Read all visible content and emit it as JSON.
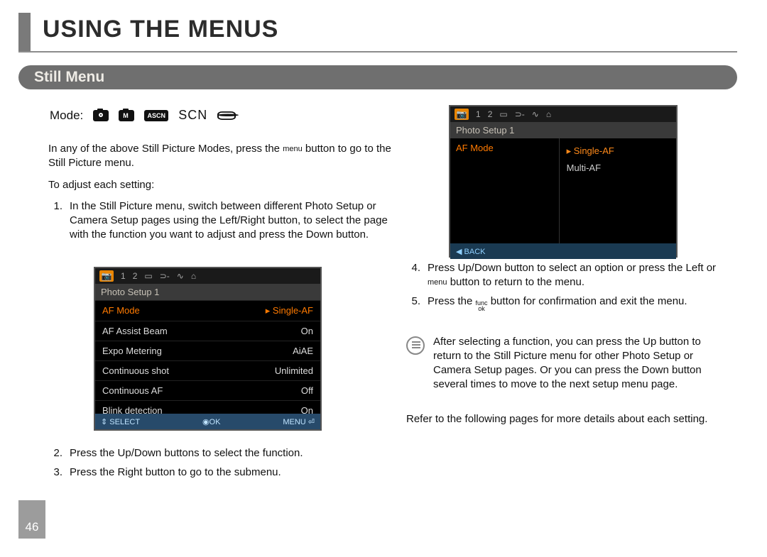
{
  "header": {
    "title": "USING THE MENUS"
  },
  "section": {
    "title": "Still Menu"
  },
  "mode": {
    "label": "Mode:",
    "ascn": "ASCN",
    "scn": "SCN"
  },
  "left": {
    "p1a": "In any of the above Still Picture Modes, press the ",
    "p1_menu": "menu",
    "p1b": " button to go to the Still  Picture menu.",
    "p2": "To adjust each setting:",
    "s1": "In the Still Picture menu, switch between different Photo Setup or Camera Setup pages using the Left/Right button, to select the page with the function you want to adjust and press the Down button.",
    "s2": "Press the Up/Down buttons to select the function.",
    "s3": "Press the Right button to go to the submenu."
  },
  "right": {
    "s4a": "Press Up/Down button to select an option or press the Left or ",
    "s4_menu": "menu",
    "s4b": " button to return to the menu.",
    "s5a": "Press the ",
    "s5_func_top": "func",
    "s5_func_bot": "ok",
    "s5b": " button for confirmation and exit the menu.",
    "note": "After selecting a function, you can press the Up button to return to the Still Picture menu for other Photo Setup or Camera Setup pages. Or you can press the Down button several times to move to the next setup menu page.",
    "closing": "Refer to the following pages for more details about each setting."
  },
  "lcd1": {
    "tabs": [
      "📷",
      "1",
      "2",
      "▭",
      "⊃-",
      "∿",
      "⌂"
    ],
    "head": "Photo Setup 1",
    "rows": [
      {
        "k": "AF Mode",
        "v": "Single-AF",
        "hl": true,
        "tri": true
      },
      {
        "k": "AF Assist Beam",
        "v": "On"
      },
      {
        "k": "Expo Metering",
        "v": "AiAE"
      },
      {
        "k": "Continuous shot",
        "v": "Unlimited"
      },
      {
        "k": "Continuous AF",
        "v": "Off"
      },
      {
        "k": "Blink detection",
        "v": "On"
      }
    ],
    "foot_left": "⇕ SELECT",
    "foot_mid": "◉OK",
    "foot_right": "MENU ⏎"
  },
  "lcd2": {
    "tabs": [
      "📷",
      "1",
      "2",
      "▭",
      "⊃-",
      "∿",
      "⌂"
    ],
    "head": "Photo Setup 1",
    "left_label": "AF Mode",
    "options": [
      {
        "t": "Single-AF",
        "sel": true
      },
      {
        "t": "Multi-AF",
        "sel": false
      }
    ],
    "foot": "◀ BACK"
  },
  "page_number": "46"
}
